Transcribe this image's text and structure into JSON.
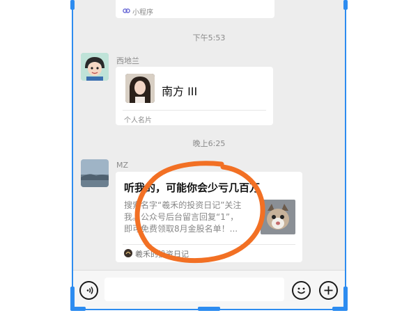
{
  "chat": {
    "prev_card": {
      "source_label": "小程序"
    },
    "timestamp_1": "下午5:53",
    "msg1": {
      "sender": "西地兰",
      "contact_card": {
        "name": "南方 III",
        "label": "个人名片"
      }
    },
    "timestamp_2": "晚上6:25",
    "msg2": {
      "sender": "MZ",
      "article": {
        "title": "听我的，可能你会少亏几百万",
        "description_lines": [
          "搜索名字“羲禾的投资日记”关注",
          "我。公众号后台留言回复“1”，",
          "即可免费领取8月金股名单！..."
        ],
        "source": "羲禾的投资日记"
      }
    }
  },
  "icons": {
    "voice": "voice-icon",
    "emoji": "emoji-icon",
    "plus": "plus-icon",
    "miniprogram": "miniprogram-icon"
  },
  "colors": {
    "accent_frame": "#2d8cf0",
    "annotation_circle": "#f27024",
    "chat_background": "#ededed"
  }
}
